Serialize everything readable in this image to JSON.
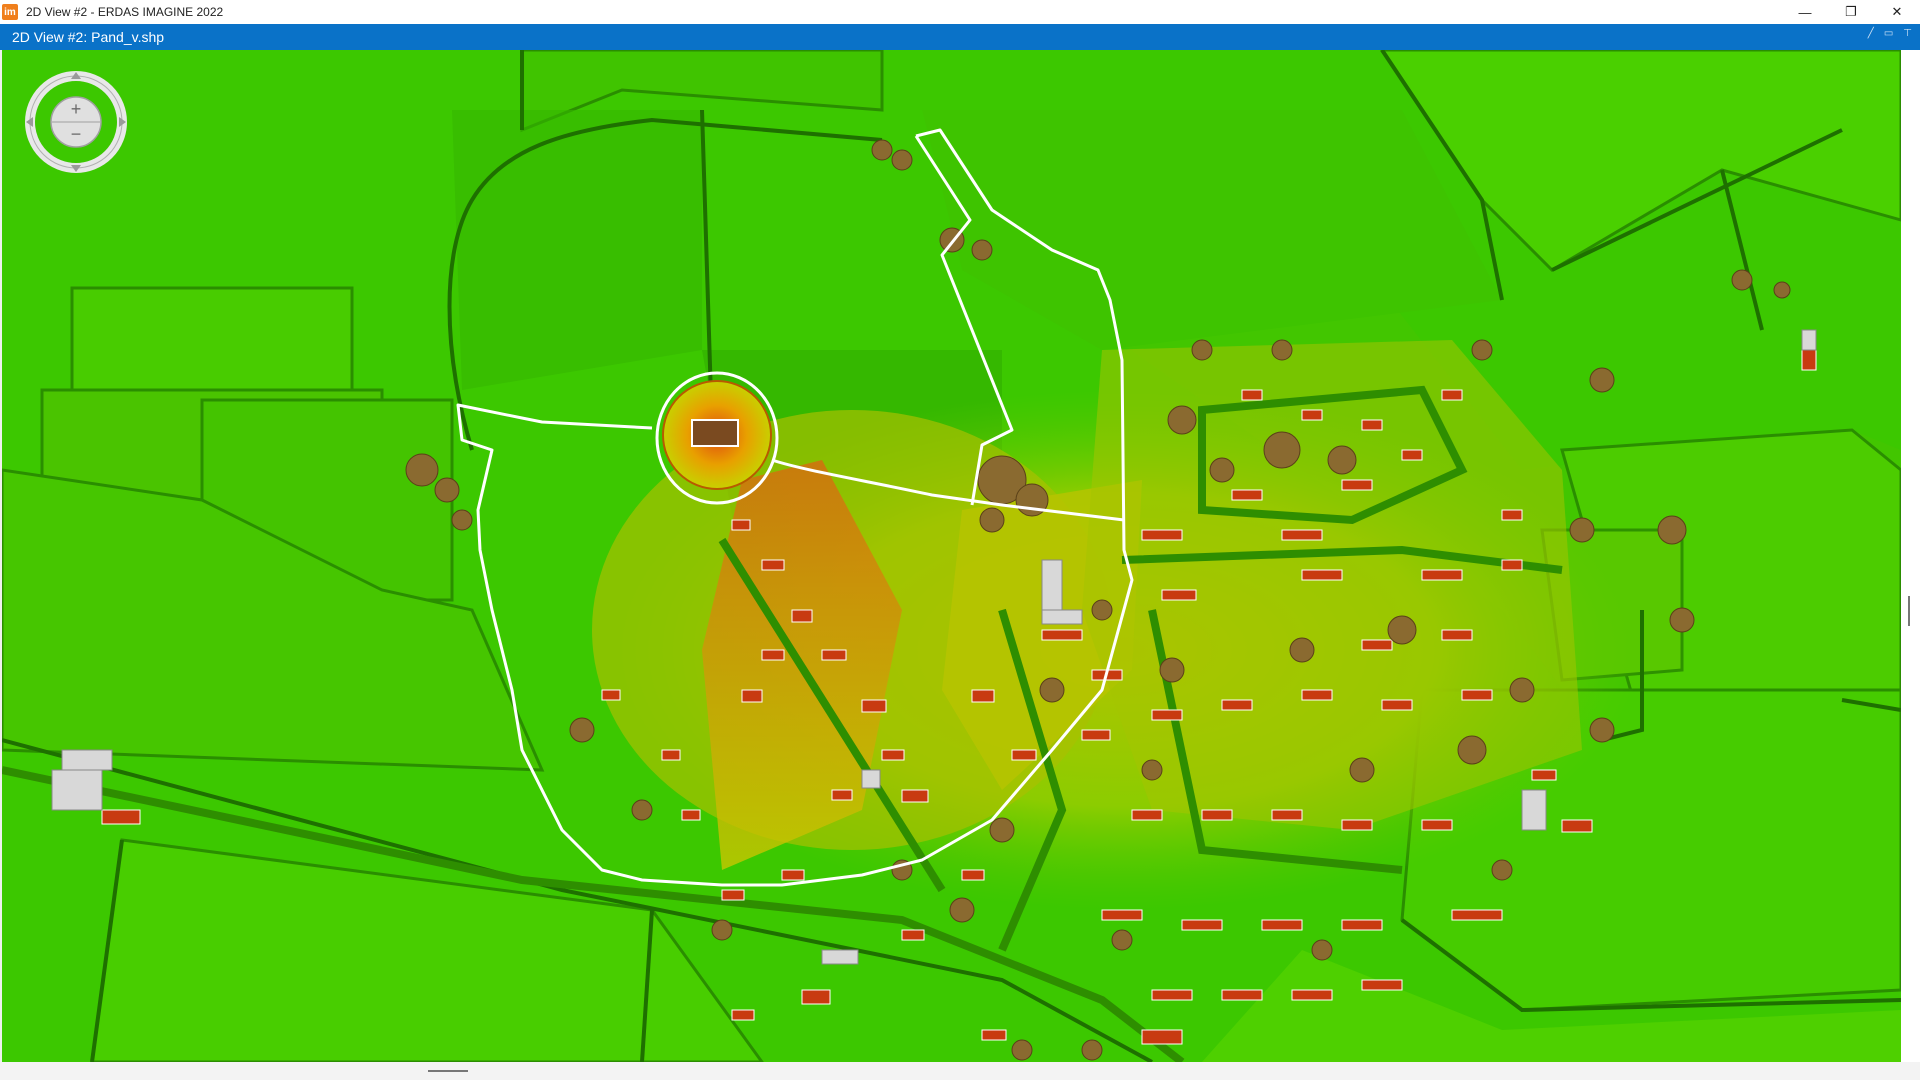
{
  "window": {
    "title": "2D View #2 - ERDAS IMAGINE 2022",
    "logo_text": "im",
    "controls": {
      "minimize": "—",
      "restore": "❐",
      "close": "✕"
    }
  },
  "view": {
    "title": "2D View #2: Pand_v.shp",
    "tools": [
      "pin-icon",
      "window-icon",
      "pushpin-icon"
    ]
  },
  "navigator": {
    "zoom_in": "+",
    "zoom_out": "−",
    "icons": [
      "pan-up-icon",
      "pan-down-icon",
      "pan-left-icon",
      "pan-right-icon",
      "zoom-in-icon",
      "zoom-out-icon"
    ]
  },
  "colors": {
    "accent": "#0a72c8",
    "terrain_low": "#3cc800",
    "terrain_mid": "#d9d000",
    "terrain_high": "#e05010",
    "vector_outline": "#ffffff"
  }
}
